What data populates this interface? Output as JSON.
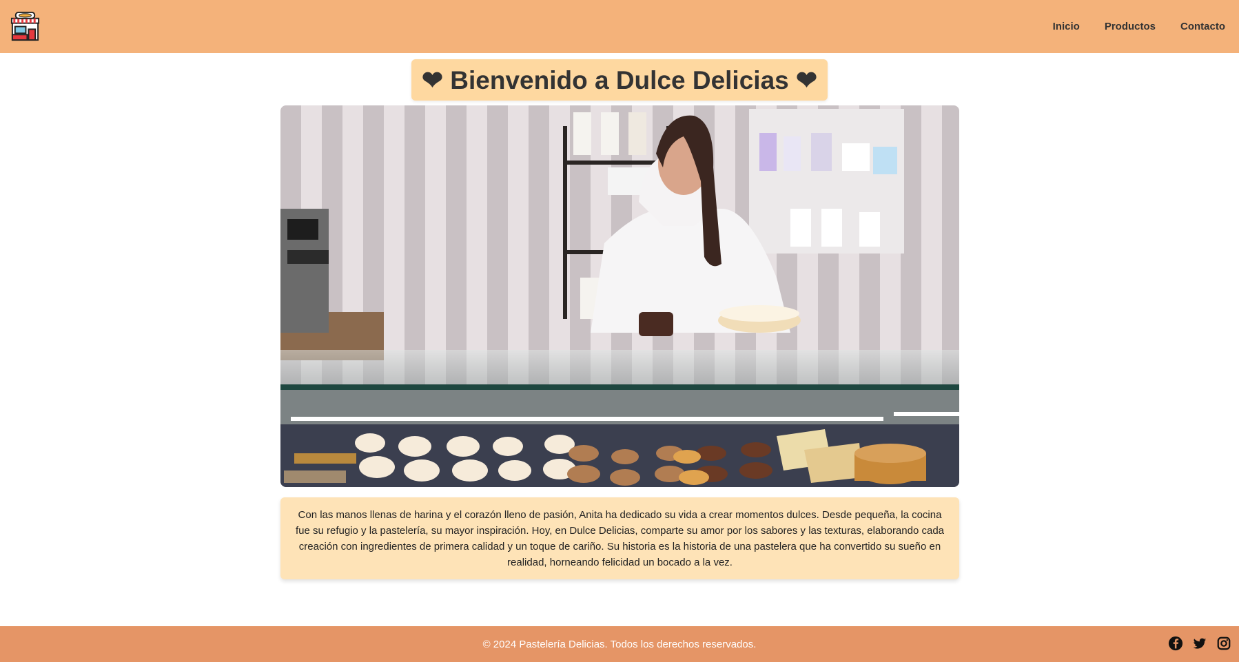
{
  "header": {
    "logo_icon": "bakery-shop-icon",
    "nav": [
      {
        "label": "Inicio"
      },
      {
        "label": "Productos"
      },
      {
        "label": "Contacto"
      }
    ]
  },
  "main": {
    "title": "❤ Bienvenido a Dulce Delicias ❤",
    "story": "Con las manos llenas de harina y el corazón lleno de pasión, Anita ha dedicado su vida a crear momentos dulces. Desde pequeña, la cocina fue su refugio y la pastelería, su mayor inspiración. Hoy, en Dulce Delicias, comparte su amor por los sabores y las texturas, elaborando cada creación con ingredientes de primera calidad y un toque de cariño. Su historia es la historia de una pastelera que ha convertido su sueño en realidad, horneando felicidad un bocado a la vez."
  },
  "footer": {
    "copyright": "© 2024 Pastelería Delicias. Todos los derechos reservados.",
    "socials": [
      "facebook-icon",
      "twitter-icon",
      "instagram-icon"
    ]
  },
  "colors": {
    "header_bg": "#f4b27a",
    "title_bg": "#fed8a0",
    "story_bg": "#fee3b7",
    "footer_bg": "#e59566"
  }
}
